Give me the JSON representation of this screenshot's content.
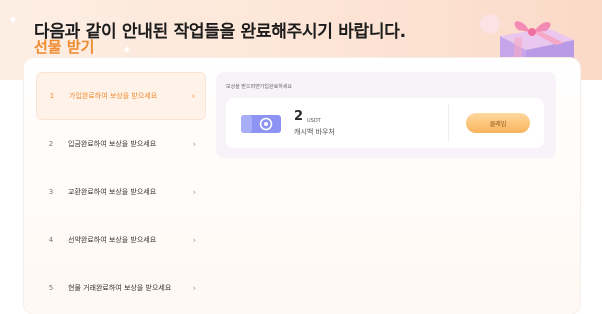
{
  "header": {
    "title": "다음과 같이 안내된 작업들을 완료해주시기 바랍니다.",
    "subtitle": "선물 받기"
  },
  "steps": [
    {
      "num": "1",
      "label": "가입완료하여 보상을 받으세요",
      "active": true
    },
    {
      "num": "2",
      "label": "입금완료하여 보상을 받으세요",
      "active": false
    },
    {
      "num": "3",
      "label": "교환완료하여 보상을 받으세요",
      "active": false
    },
    {
      "num": "4",
      "label": "선약완료하여 보상을 받으세요",
      "active": false
    },
    {
      "num": "5",
      "label": "현물 거래완료하여 보상을 받으세요",
      "active": false
    }
  ],
  "content": {
    "hint": "보상을 받으려면가입완료하세요",
    "reward": {
      "amount": "2",
      "unit": "USDT",
      "name": "캐시백 바우처",
      "claim_label": "클레임"
    }
  },
  "colors": {
    "accent": "#f08a2e",
    "button": "#f7b35a"
  }
}
